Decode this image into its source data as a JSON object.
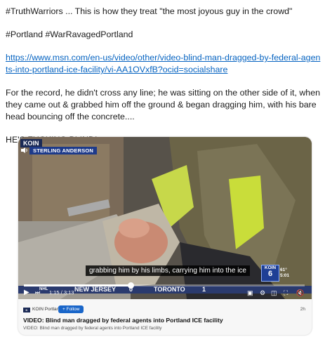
{
  "post": {
    "line1": "#TruthWarriors ... This is how they treat \"the most joyous guy in the crowd\"",
    "line2": "#Portland #WarRavagedPortland",
    "link": "https://www.msn.com/en-us/video/other/video-blind-man-dragged-by-federal-agents-into-portland-ice-facility/vi-AA1OVxfB?ocid=socialshare",
    "paragraph": "For the record, he didn't cross any line; he was sitting on the other side of it, when they came out & grabbed him off the ground & began dragging him, with his bare head bouncing off the concrete....",
    "shout": "HE'S FUCKING BLIND!"
  },
  "video": {
    "station_logo": "KOIN",
    "reporter": "STERLING ANDERSON",
    "caption": "grabbing him by his limbs, carrying him into the ice",
    "bug_label": "KOIN",
    "bug_number": "6",
    "temperature": "61°",
    "clock": "5:01",
    "ticker": [
      {
        "label": "NHL"
      },
      {
        "label": "NEW JERSEY"
      },
      {
        "label": "0"
      },
      {
        "label": "TORONTO"
      },
      {
        "label": "1"
      }
    ],
    "time_display": "1:15 / 3:13",
    "progress_fraction": 0.38,
    "controls": [
      "play-icon",
      "skip-icon",
      "volume-icon",
      "captions-icon",
      "settings-icon",
      "fullscreen-icon"
    ]
  },
  "card": {
    "source": "KOIN Portland",
    "follow_label": "+ Follow",
    "age": "2h",
    "title": "VIDEO: Blind man dragged by federal agents into Portland ICE facility",
    "subtitle": "VIDEO: Blind man dragged by federal agents into Portland ICE facility"
  }
}
